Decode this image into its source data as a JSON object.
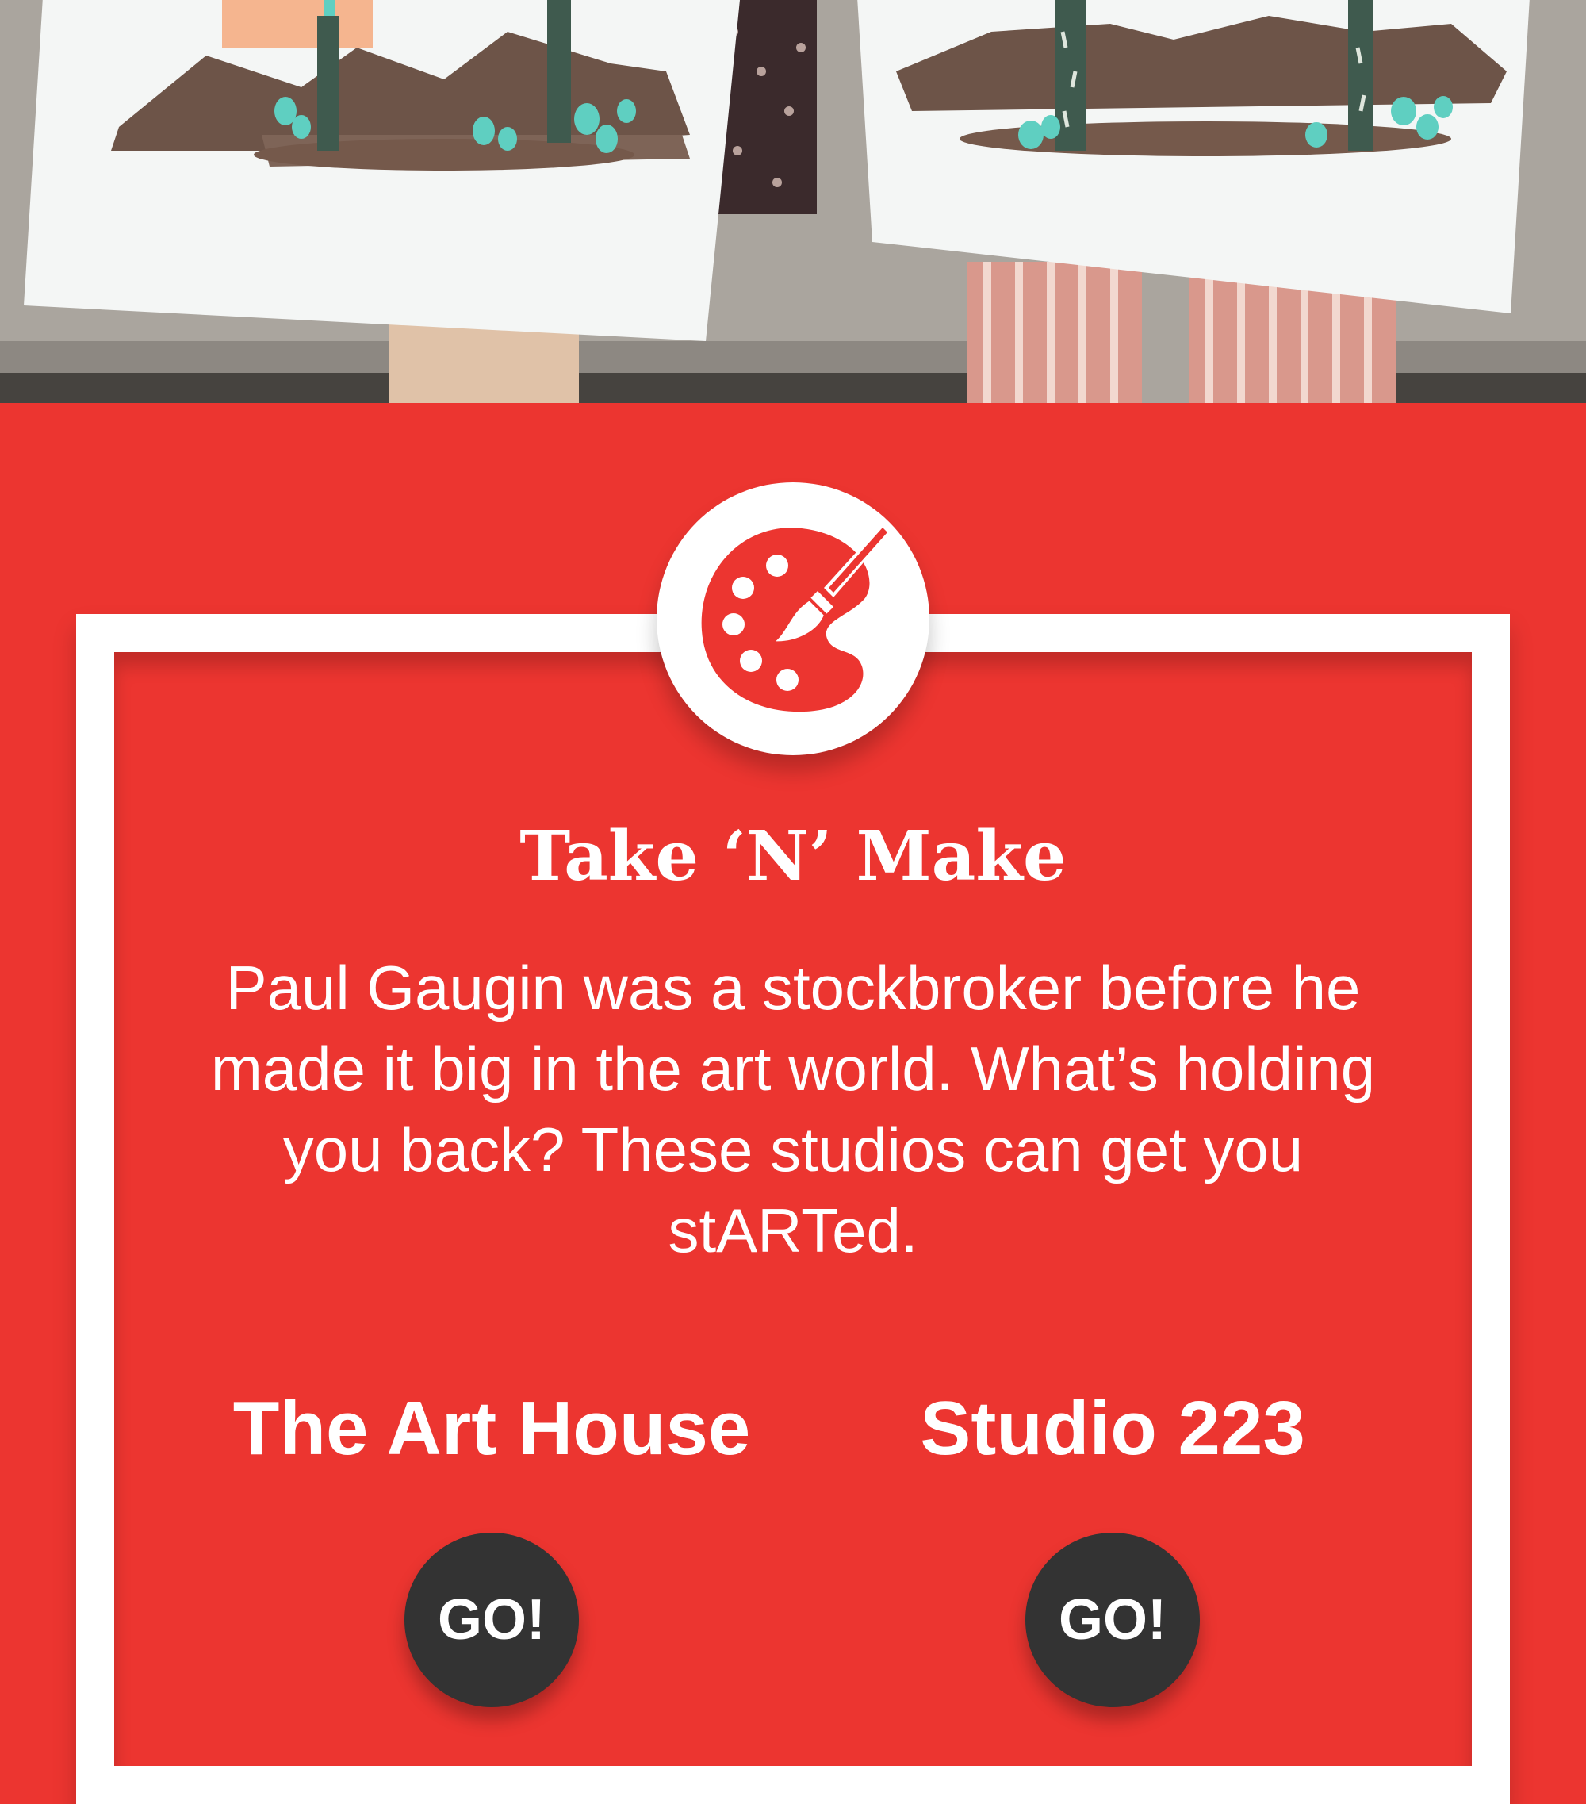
{
  "hero": {
    "image_description_icon": "photo-two-people-holding-desert-cactus-paintings"
  },
  "section": {
    "icon": "palette-brush-icon",
    "title": "Take ‘N’ Make",
    "description": "Paul Gaugin was a stockbroker before he made it big in the art world. What’s holding you back? These studios can get you stARTed."
  },
  "studios": [
    {
      "name": "The Art House",
      "button_label": "GO!"
    },
    {
      "name": "Studio 223",
      "button_label": "GO!"
    }
  ],
  "colors": {
    "background_red": "#ec3530",
    "frame_white": "#ffffff",
    "button_dark": "#333333"
  }
}
